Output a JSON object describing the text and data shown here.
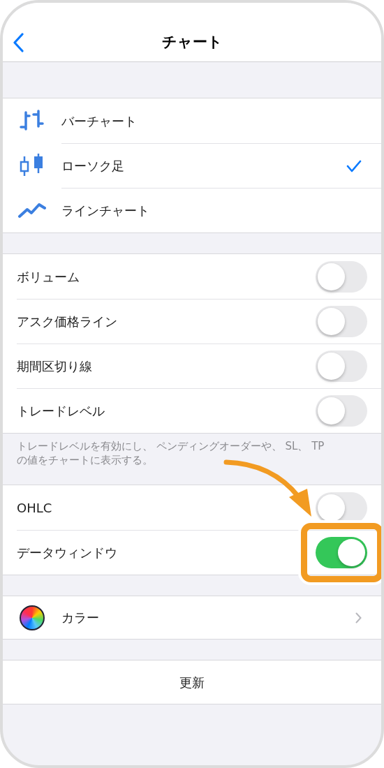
{
  "nav": {
    "title": "チャート"
  },
  "chart_types": [
    {
      "kind": "bar",
      "label": "バーチャート",
      "selected": false
    },
    {
      "kind": "candle",
      "label": "ローソク足",
      "selected": true
    },
    {
      "kind": "line",
      "label": "ラインチャート",
      "selected": false
    }
  ],
  "display_options": [
    {
      "label": "ボリューム",
      "on": false
    },
    {
      "label": "アスク価格ライン",
      "on": false
    },
    {
      "label": "期間区切り線",
      "on": false
    },
    {
      "label": "トレードレベル",
      "on": false
    }
  ],
  "display_note": "トレードレベルを有効にし、 ペンディングオーダーや、 SL、 TP の値をチャートに表示する。",
  "data_options": [
    {
      "label": "OHLC",
      "on": false,
      "highlighted": false
    },
    {
      "label": "データウィンドウ",
      "on": true,
      "highlighted": true
    }
  ],
  "color_row": {
    "label": "カラー"
  },
  "update_button": "更新"
}
